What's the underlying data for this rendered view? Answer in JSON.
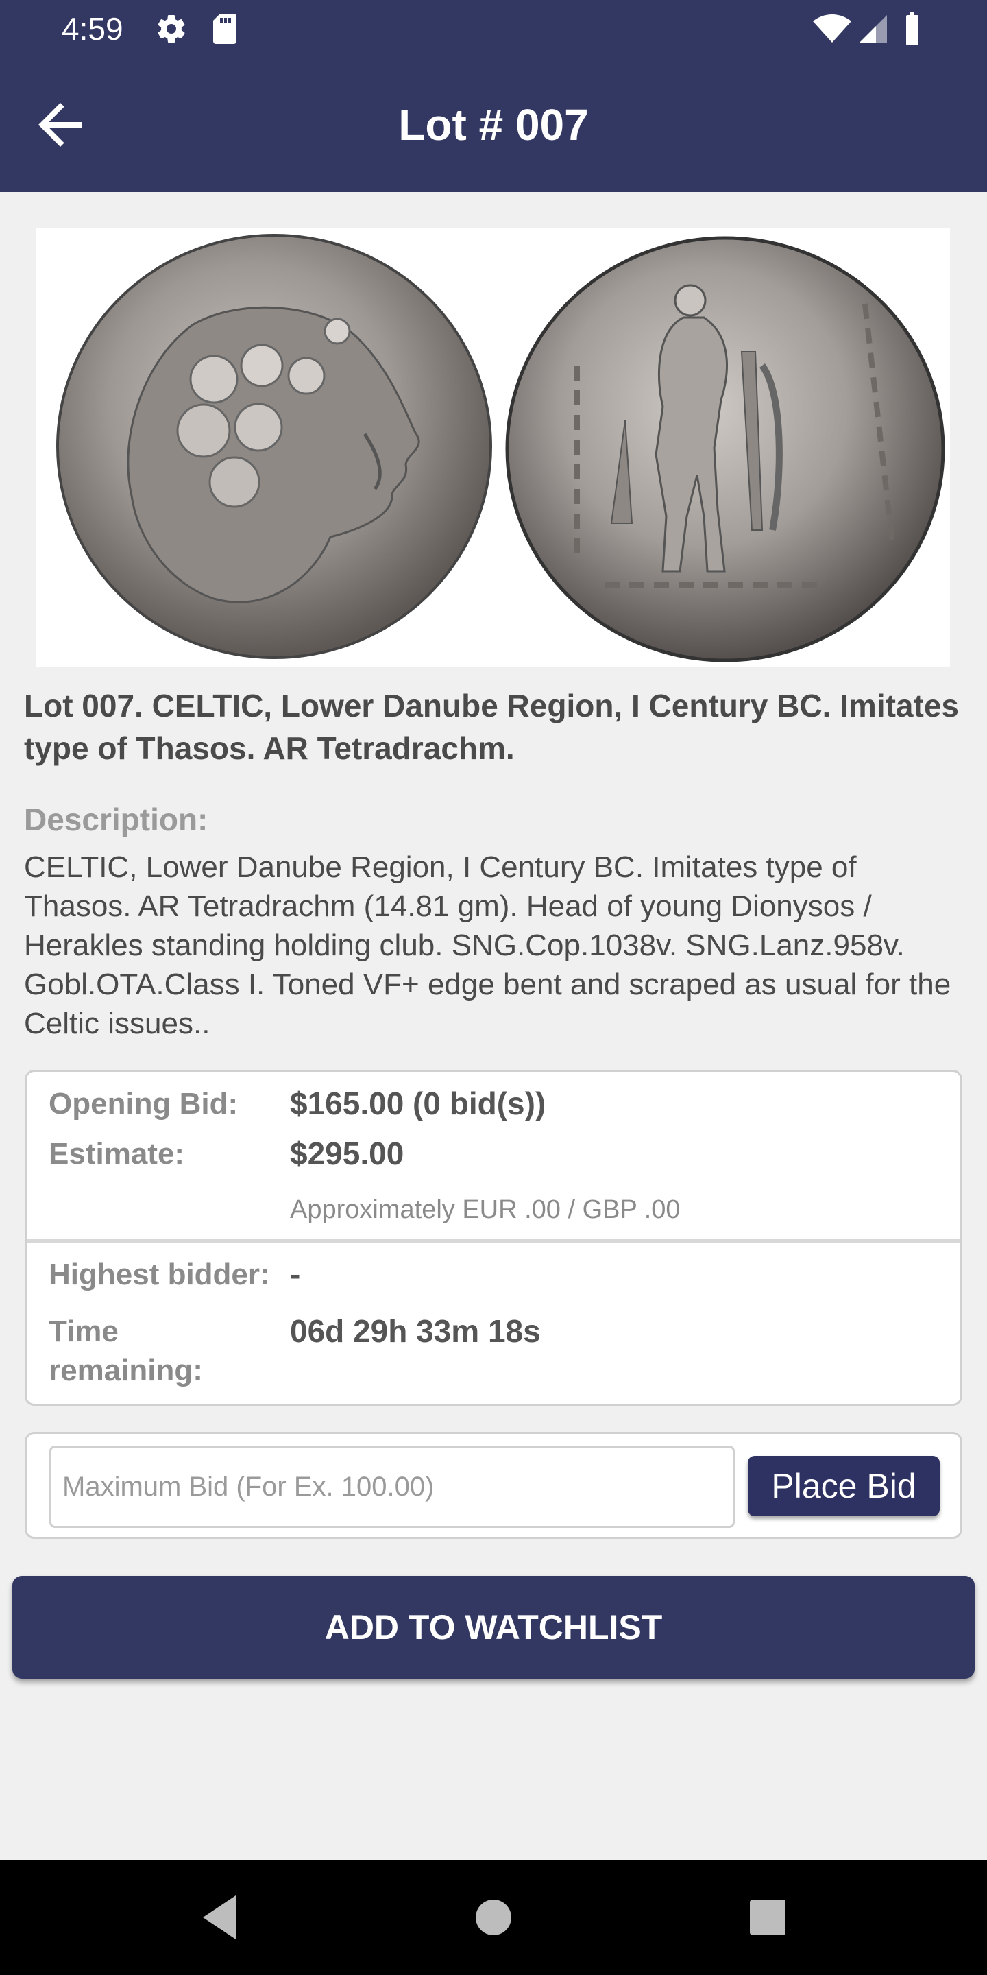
{
  "status_bar": {
    "time": "4:59",
    "icons": [
      "gear-icon",
      "sd-card-icon",
      "wifi-icon",
      "signal-icon",
      "battery-icon"
    ]
  },
  "app_bar": {
    "title": "Lot # 007",
    "back_icon": "arrow-back-icon",
    "background": "#333863"
  },
  "lot": {
    "image_alt": "coin-obverse-reverse",
    "title": "Lot 007. CELTIC, Lower Danube Region, I Century BC. Imitates type of Thasos. AR Tetradrachm.",
    "description_label": "Description:",
    "description": "CELTIC, Lower Danube Region, I Century BC. Imitates type of Thasos. AR Tetradrachm (14.81 gm). Head of young Dionysos / Herakles standing holding club. SNG.Cop.1038v. SNG.Lanz.958v. Gobl.OTA.Class I. Toned VF+ edge bent and scraped as usual for the Celtic issues.."
  },
  "bid_info": {
    "opening_bid_label": "Opening Bid:",
    "opening_bid_value": "$165.00 (0 bid(s))",
    "estimate_label": "Estimate:",
    "estimate_value": "$295.00",
    "approx_note": "Approximately EUR .00 / GBP .00",
    "highest_bidder_label": "Highest bidder:",
    "highest_bidder_value": "-",
    "time_remaining_label": "Time remaining:",
    "time_remaining_value": "06d 29h 33m 18s"
  },
  "bid_form": {
    "placeholder": "Maximum Bid (For Ex. 100.00)",
    "value": "",
    "place_bid_label": "Place Bid"
  },
  "actions": {
    "watchlist_label": "ADD TO WATCHLIST"
  },
  "nav_bar": {
    "icons": [
      "back-triangle-icon",
      "home-circle-icon",
      "recents-square-icon"
    ]
  }
}
